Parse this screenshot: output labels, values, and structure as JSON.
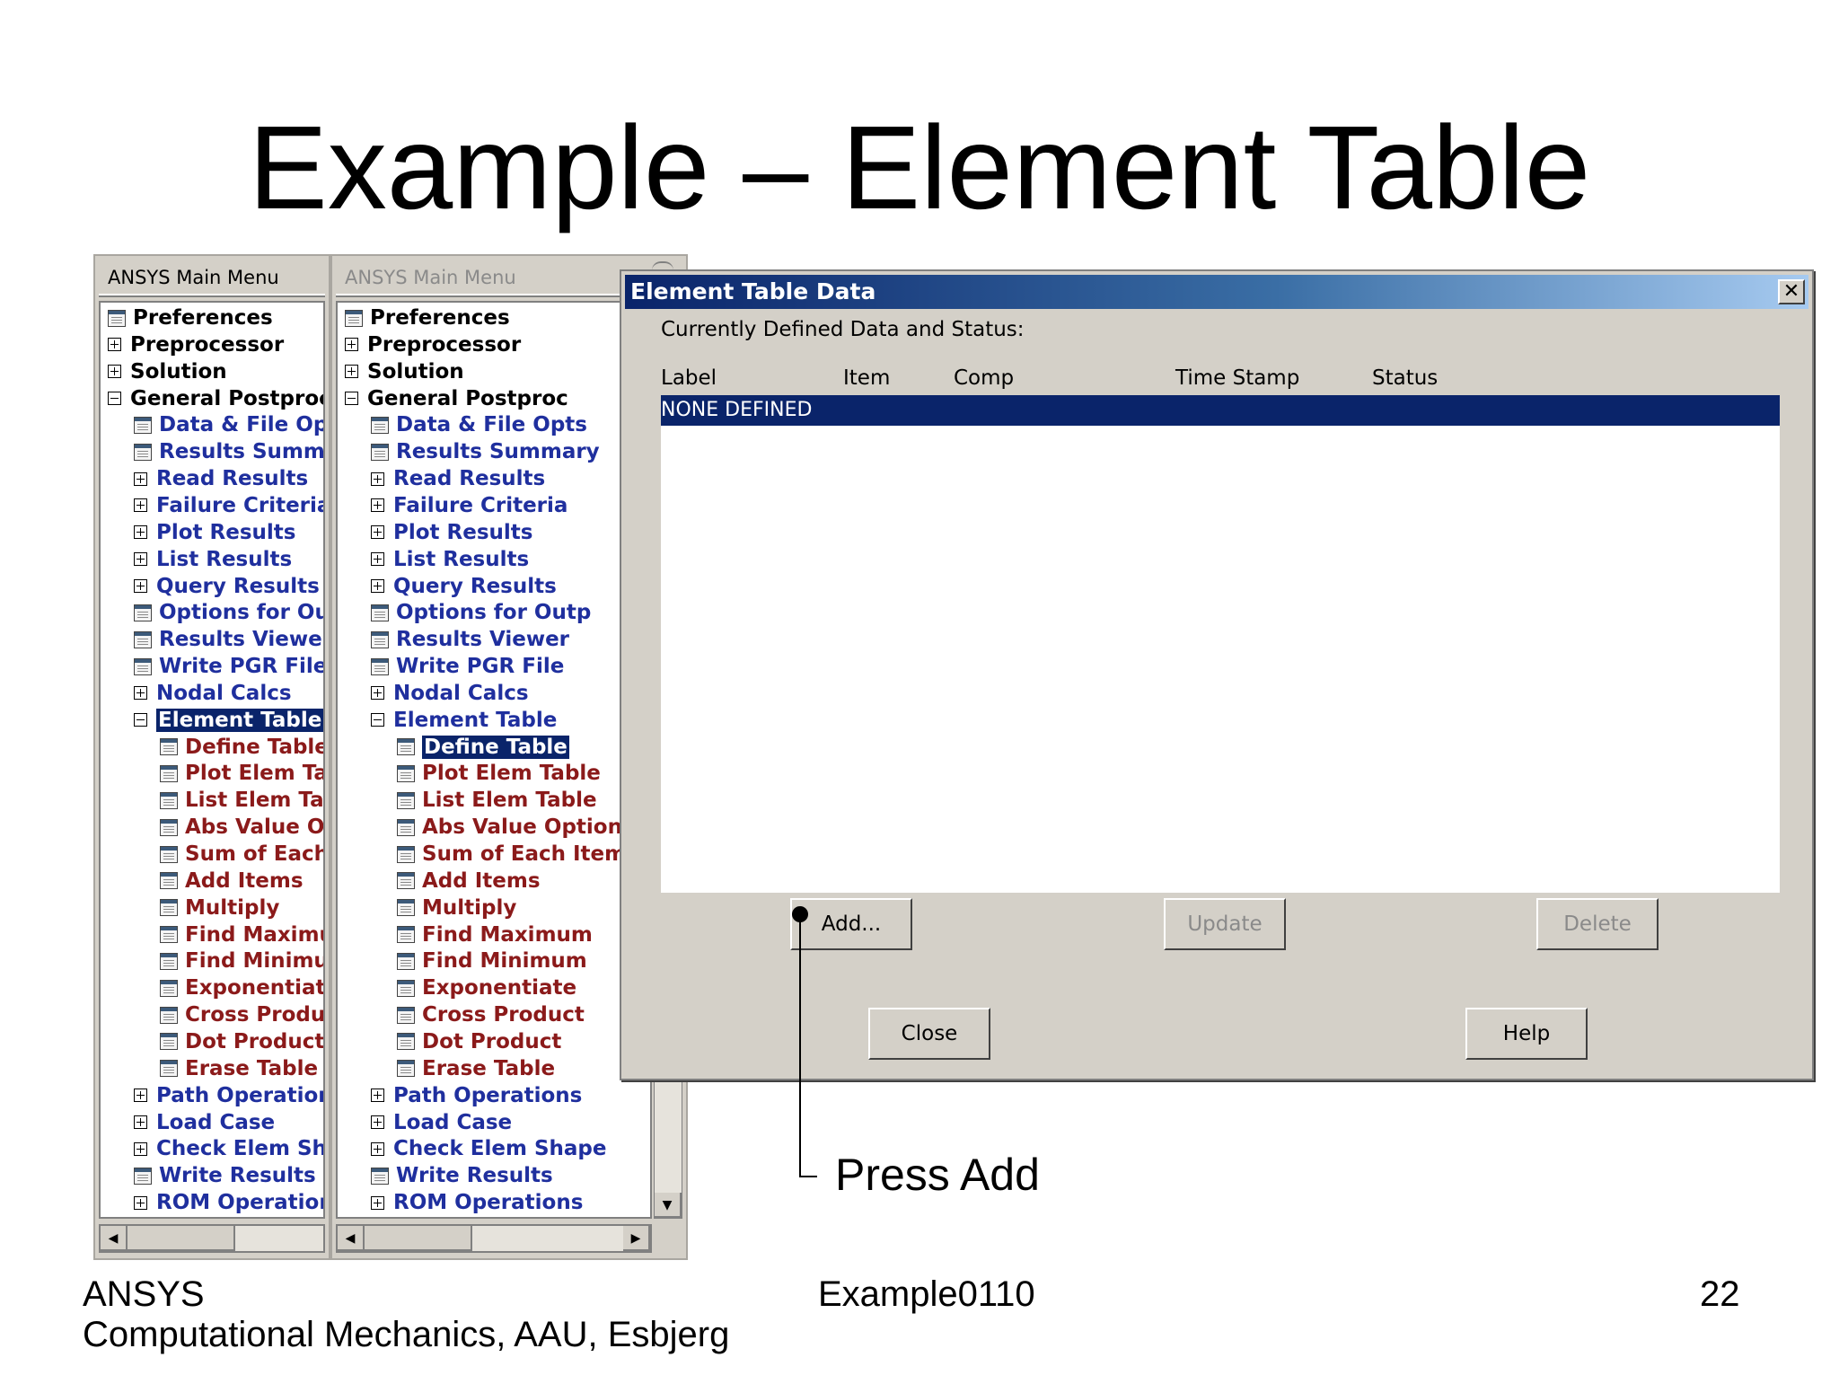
{
  "slide": {
    "title": "Example – Element Table",
    "callout": "Press Add",
    "footer": {
      "left_line1": "ANSYS",
      "left_line2": "Computational Mechanics, AAU, Esbjerg",
      "center": "Example0110",
      "page_number": "22"
    }
  },
  "menu_panel_1": {
    "title": "ANSYS Main Menu",
    "items": [
      {
        "label": "Preferences",
        "icon": "doc",
        "level": 0,
        "color": "black"
      },
      {
        "label": "Preprocessor",
        "icon": "plus",
        "level": 0,
        "color": "black"
      },
      {
        "label": "Solution",
        "icon": "plus",
        "level": 0,
        "color": "black"
      },
      {
        "label": "General Postproc",
        "icon": "minus",
        "level": 0,
        "color": "black"
      },
      {
        "label": "Data & File Opts",
        "icon": "doc",
        "level": 1,
        "color": "blue"
      },
      {
        "label": "Results Summar",
        "icon": "doc",
        "level": 1,
        "color": "blue"
      },
      {
        "label": "Read Results",
        "icon": "plus",
        "level": 1,
        "color": "blue"
      },
      {
        "label": "Failure Criteria",
        "icon": "plus",
        "level": 1,
        "color": "blue"
      },
      {
        "label": "Plot Results",
        "icon": "plus",
        "level": 1,
        "color": "blue"
      },
      {
        "label": "List Results",
        "icon": "plus",
        "level": 1,
        "color": "blue"
      },
      {
        "label": "Query Results",
        "icon": "plus",
        "level": 1,
        "color": "blue"
      },
      {
        "label": "Options for Out",
        "icon": "doc",
        "level": 1,
        "color": "blue"
      },
      {
        "label": "Results Viewer",
        "icon": "doc",
        "level": 1,
        "color": "blue"
      },
      {
        "label": "Write PGR File",
        "icon": "doc",
        "level": 1,
        "color": "blue"
      },
      {
        "label": "Nodal Calcs",
        "icon": "plus",
        "level": 1,
        "color": "blue"
      },
      {
        "label": "Element Table",
        "icon": "minus",
        "level": 1,
        "color": "blue",
        "selected": true
      },
      {
        "label": "Define Table",
        "icon": "doc",
        "level": 2,
        "color": "red"
      },
      {
        "label": "Plot Elem Tab",
        "icon": "doc",
        "level": 2,
        "color": "red"
      },
      {
        "label": "List Elem Tab",
        "icon": "doc",
        "level": 2,
        "color": "red"
      },
      {
        "label": "Abs Value Op",
        "icon": "doc",
        "level": 2,
        "color": "red"
      },
      {
        "label": "Sum of Each I",
        "icon": "doc",
        "level": 2,
        "color": "red"
      },
      {
        "label": "Add Items",
        "icon": "doc",
        "level": 2,
        "color": "red"
      },
      {
        "label": "Multiply",
        "icon": "doc",
        "level": 2,
        "color": "red"
      },
      {
        "label": "Find Maximun",
        "icon": "doc",
        "level": 2,
        "color": "red"
      },
      {
        "label": "Find Minimum",
        "icon": "doc",
        "level": 2,
        "color": "red"
      },
      {
        "label": "Exponentiate",
        "icon": "doc",
        "level": 2,
        "color": "red"
      },
      {
        "label": "Cross Produc",
        "icon": "doc",
        "level": 2,
        "color": "red"
      },
      {
        "label": "Dot Product",
        "icon": "doc",
        "level": 2,
        "color": "red"
      },
      {
        "label": "Erase Table",
        "icon": "doc",
        "level": 2,
        "color": "red"
      },
      {
        "label": "Path Operation:",
        "icon": "plus",
        "level": 1,
        "color": "blue"
      },
      {
        "label": "Load Case",
        "icon": "plus",
        "level": 1,
        "color": "blue"
      },
      {
        "label": "Check Elem Sha",
        "icon": "plus",
        "level": 1,
        "color": "blue"
      },
      {
        "label": "Write Results",
        "icon": "doc",
        "level": 1,
        "color": "blue"
      },
      {
        "label": "ROM Operation:",
        "icon": "plus",
        "level": 1,
        "color": "blue"
      }
    ]
  },
  "menu_panel_2": {
    "title": "ANSYS Main Menu",
    "items": [
      {
        "label": "Preferences",
        "icon": "doc",
        "level": 0,
        "color": "black"
      },
      {
        "label": "Preprocessor",
        "icon": "plus",
        "level": 0,
        "color": "black"
      },
      {
        "label": "Solution",
        "icon": "plus",
        "level": 0,
        "color": "black"
      },
      {
        "label": "General Postproc",
        "icon": "minus",
        "level": 0,
        "color": "black"
      },
      {
        "label": "Data & File Opts",
        "icon": "doc",
        "level": 1,
        "color": "blue"
      },
      {
        "label": "Results Summary",
        "icon": "doc",
        "level": 1,
        "color": "blue"
      },
      {
        "label": "Read Results",
        "icon": "plus",
        "level": 1,
        "color": "blue"
      },
      {
        "label": "Failure Criteria",
        "icon": "plus",
        "level": 1,
        "color": "blue"
      },
      {
        "label": "Plot Results",
        "icon": "plus",
        "level": 1,
        "color": "blue"
      },
      {
        "label": "List Results",
        "icon": "plus",
        "level": 1,
        "color": "blue"
      },
      {
        "label": "Query Results",
        "icon": "plus",
        "level": 1,
        "color": "blue"
      },
      {
        "label": "Options for Outp",
        "icon": "doc",
        "level": 1,
        "color": "blue"
      },
      {
        "label": "Results Viewer",
        "icon": "doc",
        "level": 1,
        "color": "blue"
      },
      {
        "label": "Write PGR File",
        "icon": "doc",
        "level": 1,
        "color": "blue"
      },
      {
        "label": "Nodal Calcs",
        "icon": "plus",
        "level": 1,
        "color": "blue"
      },
      {
        "label": "Element Table",
        "icon": "minus",
        "level": 1,
        "color": "blue"
      },
      {
        "label": "Define Table",
        "icon": "doc",
        "level": 2,
        "color": "red",
        "selected": true
      },
      {
        "label": "Plot Elem Table",
        "icon": "doc",
        "level": 2,
        "color": "red"
      },
      {
        "label": "List Elem Table",
        "icon": "doc",
        "level": 2,
        "color": "red"
      },
      {
        "label": "Abs Value Option",
        "icon": "doc",
        "level": 2,
        "color": "red"
      },
      {
        "label": "Sum of Each Item",
        "icon": "doc",
        "level": 2,
        "color": "red"
      },
      {
        "label": "Add Items",
        "icon": "doc",
        "level": 2,
        "color": "red"
      },
      {
        "label": "Multiply",
        "icon": "doc",
        "level": 2,
        "color": "red"
      },
      {
        "label": "Find Maximum",
        "icon": "doc",
        "level": 2,
        "color": "red"
      },
      {
        "label": "Find Minimum",
        "icon": "doc",
        "level": 2,
        "color": "red"
      },
      {
        "label": "Exponentiate",
        "icon": "doc",
        "level": 2,
        "color": "red"
      },
      {
        "label": "Cross Product",
        "icon": "doc",
        "level": 2,
        "color": "red"
      },
      {
        "label": "Dot Product",
        "icon": "doc",
        "level": 2,
        "color": "red"
      },
      {
        "label": "Erase Table",
        "icon": "doc",
        "level": 2,
        "color": "red"
      },
      {
        "label": "Path Operations",
        "icon": "plus",
        "level": 1,
        "color": "blue"
      },
      {
        "label": "Load Case",
        "icon": "plus",
        "level": 1,
        "color": "blue"
      },
      {
        "label": "Check Elem Shape",
        "icon": "plus",
        "level": 1,
        "color": "blue"
      },
      {
        "label": "Write Results",
        "icon": "doc",
        "level": 1,
        "color": "blue"
      },
      {
        "label": "ROM Operations",
        "icon": "plus",
        "level": 1,
        "color": "blue"
      }
    ]
  },
  "dialog": {
    "title": "Element Table Data",
    "close_glyph": "✕",
    "status_label": "Currently Defined Data and Status:",
    "columns": [
      "Label",
      "Item",
      "Comp",
      "Time Stamp",
      "Status"
    ],
    "rows": [
      "NONE DEFINED"
    ],
    "buttons": {
      "add": "Add...",
      "update": "Update",
      "delete": "Delete",
      "close": "Close",
      "help": "Help"
    }
  },
  "colors": {
    "selection": "#0a246a",
    "menu_blue": "#1f2f9e",
    "menu_red": "#8b1a1a",
    "dialog_gray": "#d4d0c8"
  }
}
